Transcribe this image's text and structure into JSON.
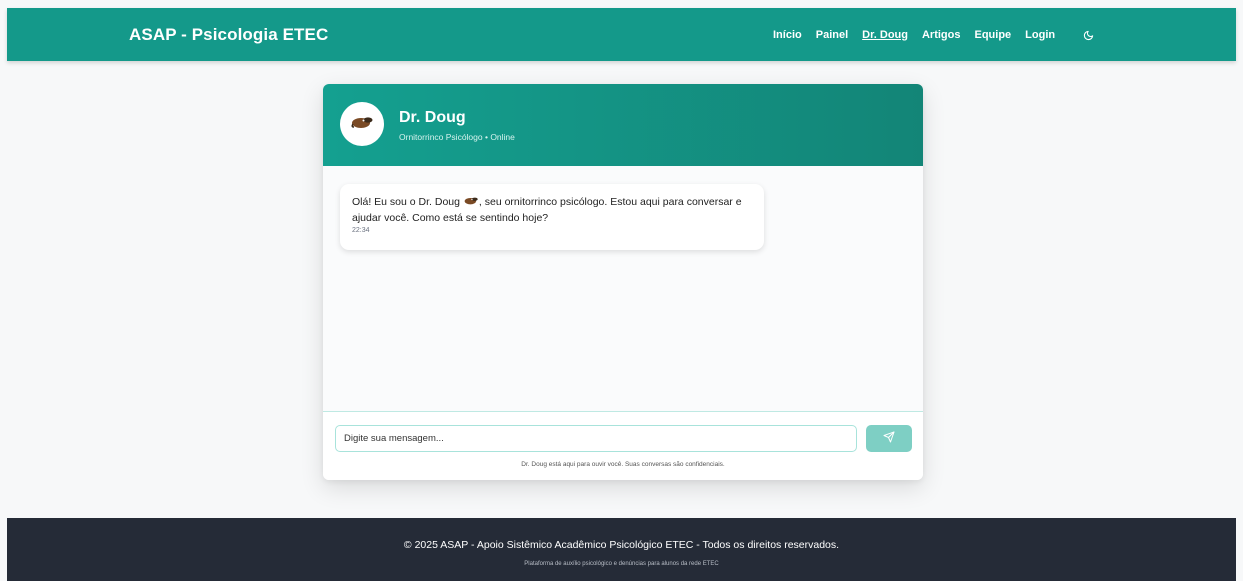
{
  "header": {
    "brand": "ASAP - Psicologia ETEC",
    "nav": [
      {
        "label": "Início",
        "active": false
      },
      {
        "label": "Painel",
        "active": false
      },
      {
        "label": "Dr. Doug",
        "active": true
      },
      {
        "label": "Artigos",
        "active": false
      },
      {
        "label": "Equipe",
        "active": false
      },
      {
        "label": "Login",
        "active": false
      }
    ],
    "theme_toggle_icon": "moon-icon"
  },
  "chat": {
    "name": "Dr. Doug",
    "subtitle": "Ornitorrinco Psicólogo • Online",
    "avatar_icon": "platypus-icon",
    "messages": [
      {
        "text_before_emoji": "Olá! Eu sou o Dr. Doug ",
        "emoji_icon": "platypus-emoji-icon",
        "text_after_emoji": ", seu ornitorrinco psicólogo. Estou aqui para conversar e ajudar você. Como está se sentindo hoje?",
        "time": "22:34"
      }
    ],
    "input": {
      "placeholder": "Digite sua mensagem...",
      "value": ""
    },
    "send_icon": "send-icon",
    "note": "Dr. Doug está aqui para ouvir você. Suas conversas são confidenciais."
  },
  "footer": {
    "main": "© 2025 ASAP - Apoio Sistêmico Acadêmico Psicológico ETEC - Todos os direitos reservados.",
    "sub": "Plataforma de auxílio psicológico e denúncias para alunos da rede ETEC"
  },
  "colors": {
    "primary": "#14998a",
    "send_button": "#7ecfc4",
    "footer_bg": "#252b37"
  }
}
